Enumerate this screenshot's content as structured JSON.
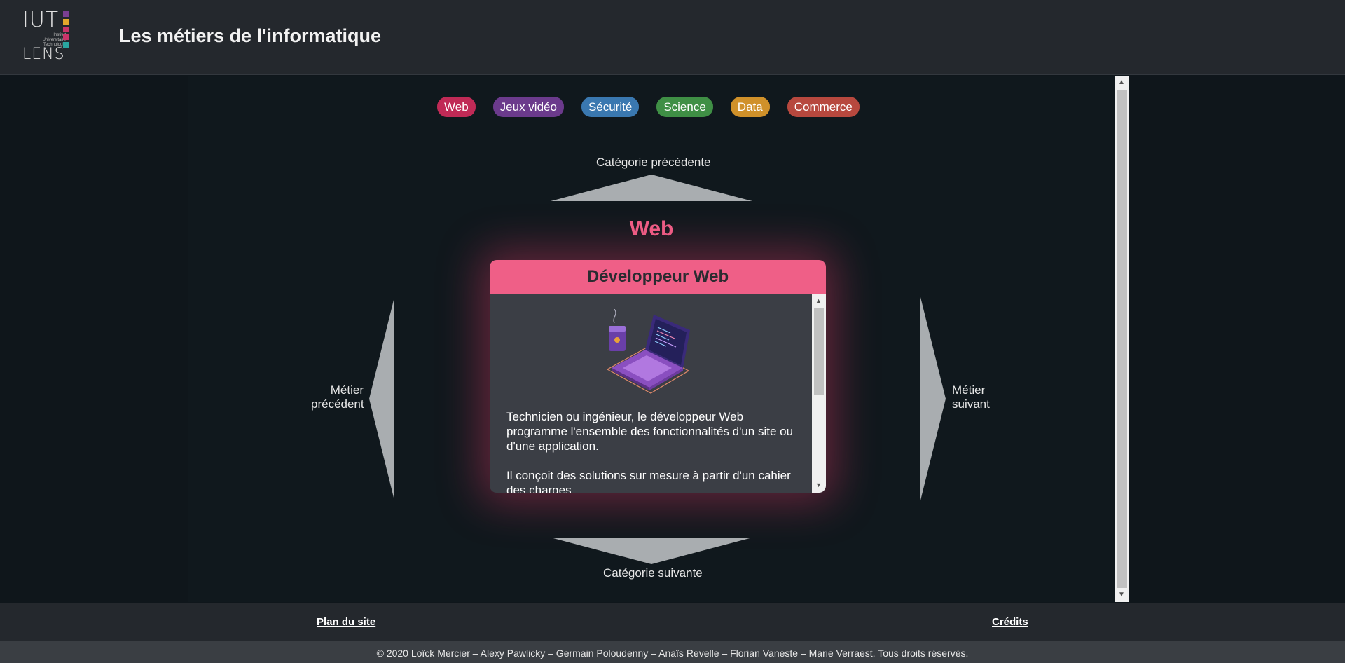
{
  "header": {
    "logo": {
      "top_text": "IUT",
      "bottom_text": "LENS",
      "small_text": [
        "Institut",
        "Universitaire",
        "Technologie"
      ]
    },
    "title": "Les métiers de l'informatique"
  },
  "categories": [
    {
      "label": "Web",
      "color": "#c02a56"
    },
    {
      "label": "Jeux vidéo",
      "color": "#6b3a8c"
    },
    {
      "label": "Sécurité",
      "color": "#3a78b0"
    },
    {
      "label": "Science",
      "color": "#3f8f45"
    },
    {
      "label": "Data",
      "color": "#d0912a"
    },
    {
      "label": "Commerce",
      "color": "#b7483e"
    }
  ],
  "nav": {
    "prev_category": "Catégorie précédente",
    "next_category": "Catégorie suivante",
    "prev_job": [
      "Métier",
      "précédent"
    ],
    "next_job": [
      "Métier",
      "suivant"
    ]
  },
  "current_category": {
    "label": "Web",
    "color": "#ef5f87"
  },
  "job_card": {
    "title": "Développeur Web",
    "illustration": "laptop-coffee-illustration",
    "paragraphs": [
      "Technicien ou ingénieur, le développeur Web programme l'ensemble des fonctionnalités d'un site ou d'une application.",
      "Il conçoit des solutions sur mesure à partir d'un cahier des charges."
    ]
  },
  "footer": {
    "sitemap_link": "Plan du site",
    "credits_link": "Crédits",
    "copyright": "© 2020 Loïck Mercier – Alexy Pawlicky – Germain Poloudenny – Anaïs Revelle – Florian Vaneste – Marie Verraest. Tous droits réservés."
  },
  "colors": {
    "background": "#0f161b",
    "header_bg": "#24282d",
    "accent": "#ef5f87",
    "arrow": "#a9adb0"
  }
}
